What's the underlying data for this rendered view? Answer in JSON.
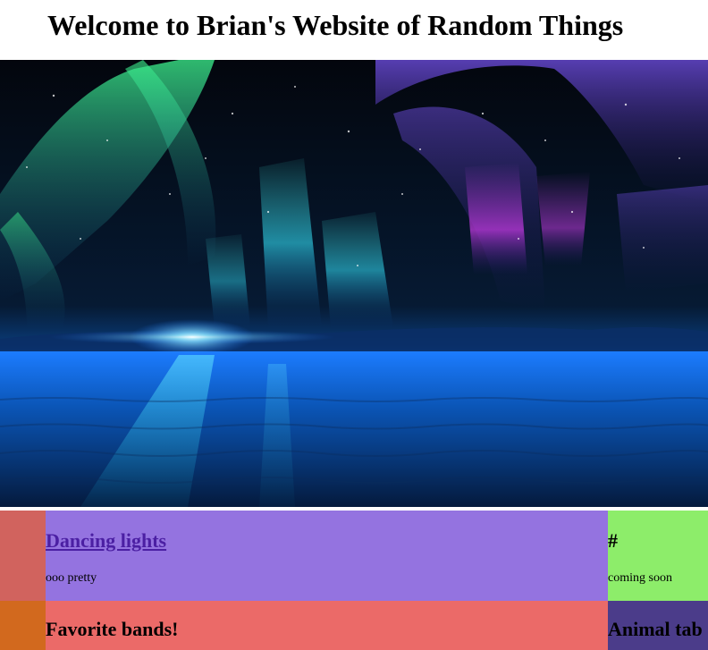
{
  "header": {
    "title": "Welcome to Brian's Website of Random Things"
  },
  "hero": {
    "description": ""
  },
  "cards": [
    {
      "title": "Dancing lights",
      "description": "ooo pretty"
    },
    {
      "title": "#",
      "description": "coming soon"
    },
    {
      "title": "Favorite bands!"
    },
    {
      "title": "Animal tab"
    }
  ],
  "colors": {
    "row1_left": "#d1635e",
    "row1_mid": "#9473e0",
    "row1_right": "#8ded6a",
    "row2_left": "#d2691e",
    "row2_mid": "#eb6a68",
    "row2_right": "#4b3c8a",
    "link": "#4b1fa3"
  }
}
